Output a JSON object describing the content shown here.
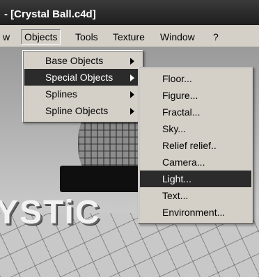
{
  "window": {
    "title": "- [Crystal Ball.c4d]"
  },
  "menubar": {
    "items": [
      {
        "label": "w"
      },
      {
        "label": "Objects"
      },
      {
        "label": "Tools"
      },
      {
        "label": "Texture"
      },
      {
        "label": "Window"
      },
      {
        "label": "?"
      }
    ]
  },
  "objects_menu": {
    "items": [
      {
        "label": "Base Objects"
      },
      {
        "label": "Special Objects"
      },
      {
        "label": "Splines"
      },
      {
        "label": "Spline Objects"
      }
    ],
    "highlighted": "Special Objects"
  },
  "special_objects_menu": {
    "items": [
      {
        "label": "Floor..."
      },
      {
        "label": "Figure..."
      },
      {
        "label": "Fractal..."
      },
      {
        "label": "Sky..."
      },
      {
        "label": "Relief relief.."
      },
      {
        "label": "Camera..."
      },
      {
        "label": "Light..."
      },
      {
        "label": "Text..."
      },
      {
        "label": "Environment..."
      }
    ],
    "highlighted": "Light..."
  },
  "viewport": {
    "scene_text": "YSTiC"
  }
}
